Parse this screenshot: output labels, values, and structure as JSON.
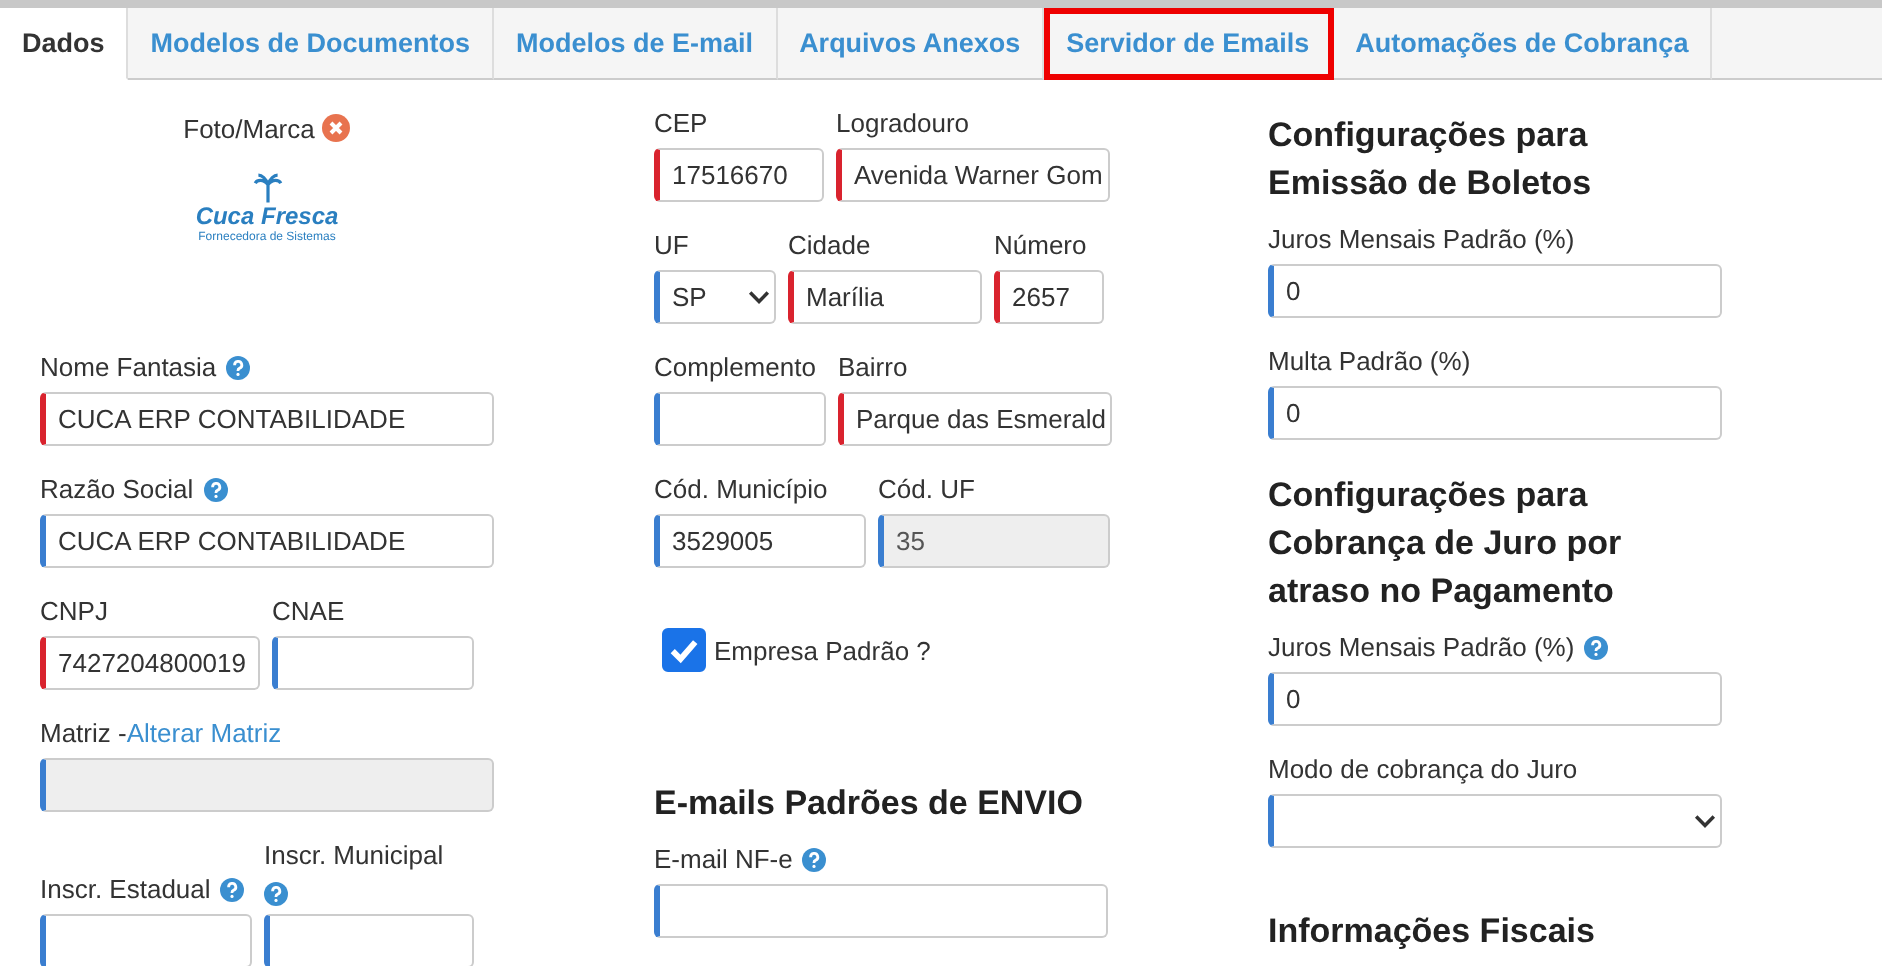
{
  "tabs": [
    {
      "label": "Dados",
      "selected": true,
      "highlighted": false
    },
    {
      "label": "Modelos de Documentos",
      "selected": false,
      "highlighted": false
    },
    {
      "label": "Modelos de E-mail",
      "selected": false,
      "highlighted": false
    },
    {
      "label": "Arquivos Anexos",
      "selected": false,
      "highlighted": false
    },
    {
      "label": "Servidor de Emails",
      "selected": false,
      "highlighted": true
    },
    {
      "label": "Automações de Cobrança",
      "selected": false,
      "highlighted": false
    }
  ],
  "columns": [
    {
      "items": [
        {
          "kind": "photo",
          "label": "Foto/Marca",
          "removable": true,
          "logo_name": "Cuca Fresca",
          "logo_tagline": "Fornecedora de Sistemas"
        },
        {
          "kind": "field",
          "label": "Nome Fantasia",
          "help": true,
          "value": "CUCA ERP CONTABILIDADE",
          "required": true
        },
        {
          "kind": "field",
          "label": "Razão Social",
          "help": true,
          "value": "CUCA ERP CONTABILIDADE",
          "required": false
        },
        {
          "kind": "row",
          "fields": [
            {
              "label": "CNPJ",
              "value": "7427204800019",
              "required": true
            },
            {
              "label": "CNAE",
              "required": false
            }
          ]
        },
        {
          "kind": "field",
          "label": "Matriz - ",
          "link": "Alterar Matriz",
          "required": false,
          "disabled": true
        },
        {
          "kind": "row",
          "fields": [
            {
              "label": "Inscr. Estadual",
              "help": true,
              "required": false
            },
            {
              "label": "Inscr. Municipal",
              "help": true,
              "required": false
            }
          ]
        }
      ]
    },
    {
      "items": [
        {
          "kind": "row",
          "fields": [
            {
              "label": "CEP",
              "value": "17516670",
              "required": true
            },
            {
              "label": "Logradouro",
              "value": "Avenida Warner Gom",
              "required": true
            }
          ]
        },
        {
          "kind": "row",
          "fields": [
            {
              "label": "UF",
              "value": "SP",
              "required": false,
              "select": true
            },
            {
              "label": "Cidade",
              "value": "Marília",
              "required": true
            },
            {
              "label": "Número",
              "value": "2657",
              "required": true
            }
          ]
        },
        {
          "kind": "row",
          "fields": [
            {
              "label": "Complemento",
              "required": false
            },
            {
              "label": "Bairro",
              "value": "Parque das Esmerald",
              "required": true
            }
          ]
        },
        {
          "kind": "row",
          "fields": [
            {
              "label": "Cód. Município",
              "value": "3529005",
              "required": false
            },
            {
              "label": "Cód. UF",
              "value": "35",
              "required": false,
              "disabled": true
            }
          ]
        },
        {
          "kind": "checkbox",
          "label": "Empresa Padrão ?",
          "checked": true
        },
        {
          "kind": "heading",
          "text": "E-mails Padrões de ENVIO"
        },
        {
          "kind": "field",
          "label": "E-mail NF-e",
          "help": true,
          "required": false
        }
      ]
    },
    {
      "items": [
        {
          "kind": "heading",
          "text": "Configurações para Emissão de Boletos"
        },
        {
          "kind": "field",
          "label": "Juros Mensais Padrão (%)",
          "value": "0",
          "required": false
        },
        {
          "kind": "field",
          "label": "Multa Padrão (%)",
          "value": "0",
          "required": false
        },
        {
          "kind": "heading",
          "text": "Configurações para Cobrança de Juro por atraso no Pagamento"
        },
        {
          "kind": "field",
          "label": "Juros Mensais Padrão (%)",
          "help": true,
          "value": "0",
          "required": false
        },
        {
          "kind": "field",
          "label": "Modo de cobrança do Juro",
          "required": false,
          "select": true
        },
        {
          "kind": "heading",
          "text": "Informações Fiscais"
        }
      ]
    }
  ]
}
